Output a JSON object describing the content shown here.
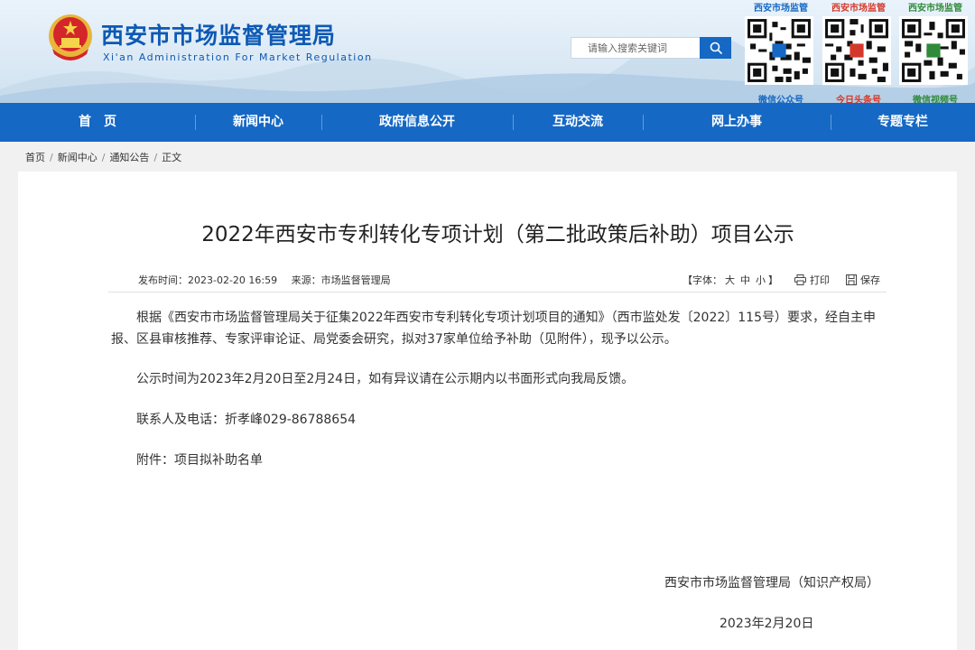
{
  "header": {
    "title": "西安市市场监督管理局",
    "subtitle": "Xi'an Administration For Market Regulation",
    "search_placeholder": "请输入搜索关键词",
    "qr_codes": [
      {
        "top_label": "西安市场监管",
        "bottom_label": "微信公众号"
      },
      {
        "top_label": "西安市场监管",
        "bottom_label": "今日头条号"
      },
      {
        "top_label": "西安市场监管",
        "bottom_label": "微信视频号"
      }
    ]
  },
  "nav": {
    "items": [
      "首　页",
      "新闻中心",
      "政府信息公开",
      "互动交流",
      "网上办事",
      "专题专栏"
    ]
  },
  "breadcrumb": {
    "items": [
      "首页",
      "新闻中心",
      "通知公告",
      "正文"
    ],
    "separator": "/"
  },
  "article": {
    "title": "2022年西安市专利转化专项计划（第二批政策后补助）项目公示",
    "publish_time": "发布时间：2023-02-20 16:59",
    "source": "来源：市场监督管理局",
    "font_label_prefix": "【字体：",
    "font_sizes": [
      "大",
      "中",
      "小"
    ],
    "font_label_suffix": "】",
    "print_label": "打印",
    "save_label": "保存",
    "paragraphs": [
      "根据《西安市市场监督管理局关于征集2022年西安市专利转化专项计划项目的通知》（西市监处发〔2022〕115号）要求，经自主申报、区县审核推荐、专家评审论证、局党委会研究，拟对37家单位给予补助（见附件），现予以公示。",
      "公示时间为2023年2月20日至2月24日，如有异议请在公示期内以书面形式向我局反馈。",
      "联系人及电话：折孝峰029-86788654",
      "附件：项目拟补助名单"
    ],
    "signature_org": "西安市市场监督管理局（知识产权局）",
    "signature_date": "2023年2月20日"
  },
  "colors": {
    "nav_blue": "#1568c4",
    "title_blue": "#0d59b4",
    "emblem_red": "#d4252a",
    "emblem_gold": "#e8b53a"
  }
}
